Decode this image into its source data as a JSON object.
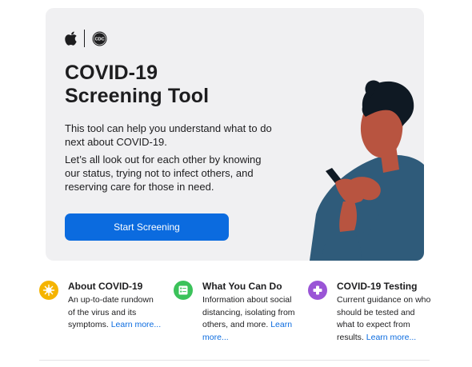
{
  "hero": {
    "title_line1": "COVID-19",
    "title_line2": "Screening Tool",
    "paragraph1": "This tool can help you understand what to do next about COVID-19.",
    "paragraph2": "Let’s all look out for each other by knowing our status, trying not to infect others, and reserving care for those in need.",
    "button_label": "Start Screening",
    "logos": [
      "apple-logo",
      "cdc-logo"
    ],
    "cdc_logo_text": "CDC"
  },
  "info_cards": [
    {
      "title": "About COVID-19",
      "description": "An up-to-date rundown of the virus and its symptoms.",
      "link": "Learn more...",
      "icon": "virus-icon",
      "color": "#f5b400"
    },
    {
      "title": "What You Can Do",
      "description": "Information about social distancing, isolating from others, and more.",
      "link": "Learn more...",
      "icon": "checklist-icon",
      "color": "#3bc25a"
    },
    {
      "title": "COVID-19 Testing",
      "description": "Current guidance on who should be tested and what to expect from results.",
      "link": "Learn more...",
      "icon": "plus-icon",
      "color": "#9a55d6"
    }
  ],
  "colors": {
    "accent": "#0b6bdf",
    "hero_background": "#f0f0f2",
    "text": "#1d1d1f"
  }
}
